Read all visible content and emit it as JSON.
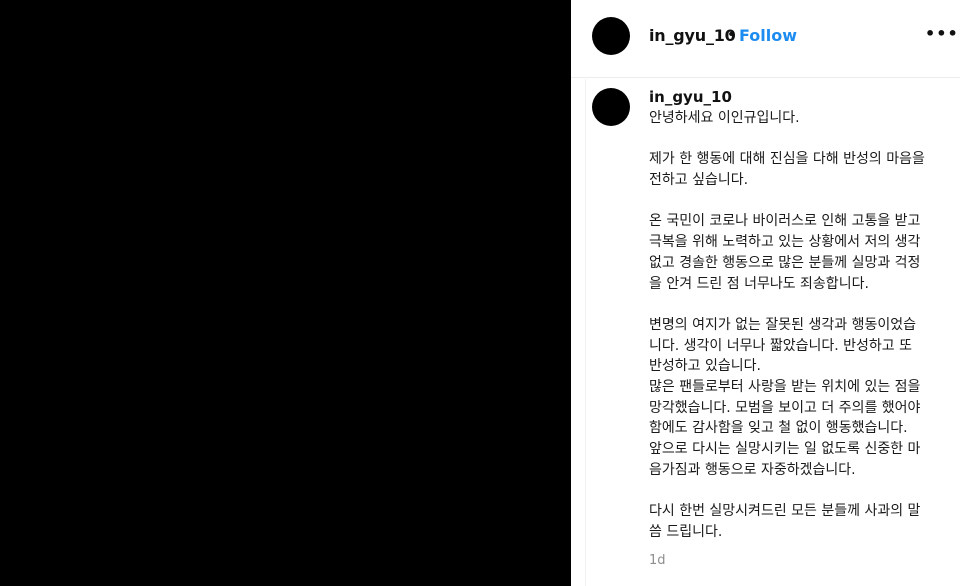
{
  "post": {
    "username": "in_gyu_10",
    "separator": "•",
    "follow_label": "Follow",
    "more_label": "•••"
  },
  "comment": {
    "username": "in_gyu_10",
    "lines": [
      "안녕하세요 이인규입니다.",
      "",
      "제가 한 행동에 대해 진심을 다해 반성의 마음을",
      "전하고 싶습니다.",
      "",
      "온 국민이 코로나 바이러스로 인해 고통을 받고",
      "극복을 위해 노력하고 있는 상황에서 저의 생각",
      "없고 경솔한 행동으로 많은 분들께 실망과 걱정",
      "을 안겨 드린 점 너무나도 죄송합니다.",
      "",
      "변명의 여지가 없는 잘못된 생각과 행동이었습",
      "니다. 생각이 너무나 짧았습니다. 반성하고 또",
      "반성하고 있습니다.",
      "많은 팬들로부터 사랑을 받는 위치에 있는 점을",
      "망각했습니다. 모범을 보이고 더 주의를 했어야",
      "함에도 감사함을 잊고 철 없이 행동했습니다.",
      "앞으로 다시는 실망시키는 일 없도록 신중한 마",
      "음가짐과 행동으로 자중하겠습니다.",
      "",
      "다시 한번 실망시켜드린 모든 분들께 사과의 말",
      "씀 드립니다."
    ],
    "time": "1d"
  }
}
